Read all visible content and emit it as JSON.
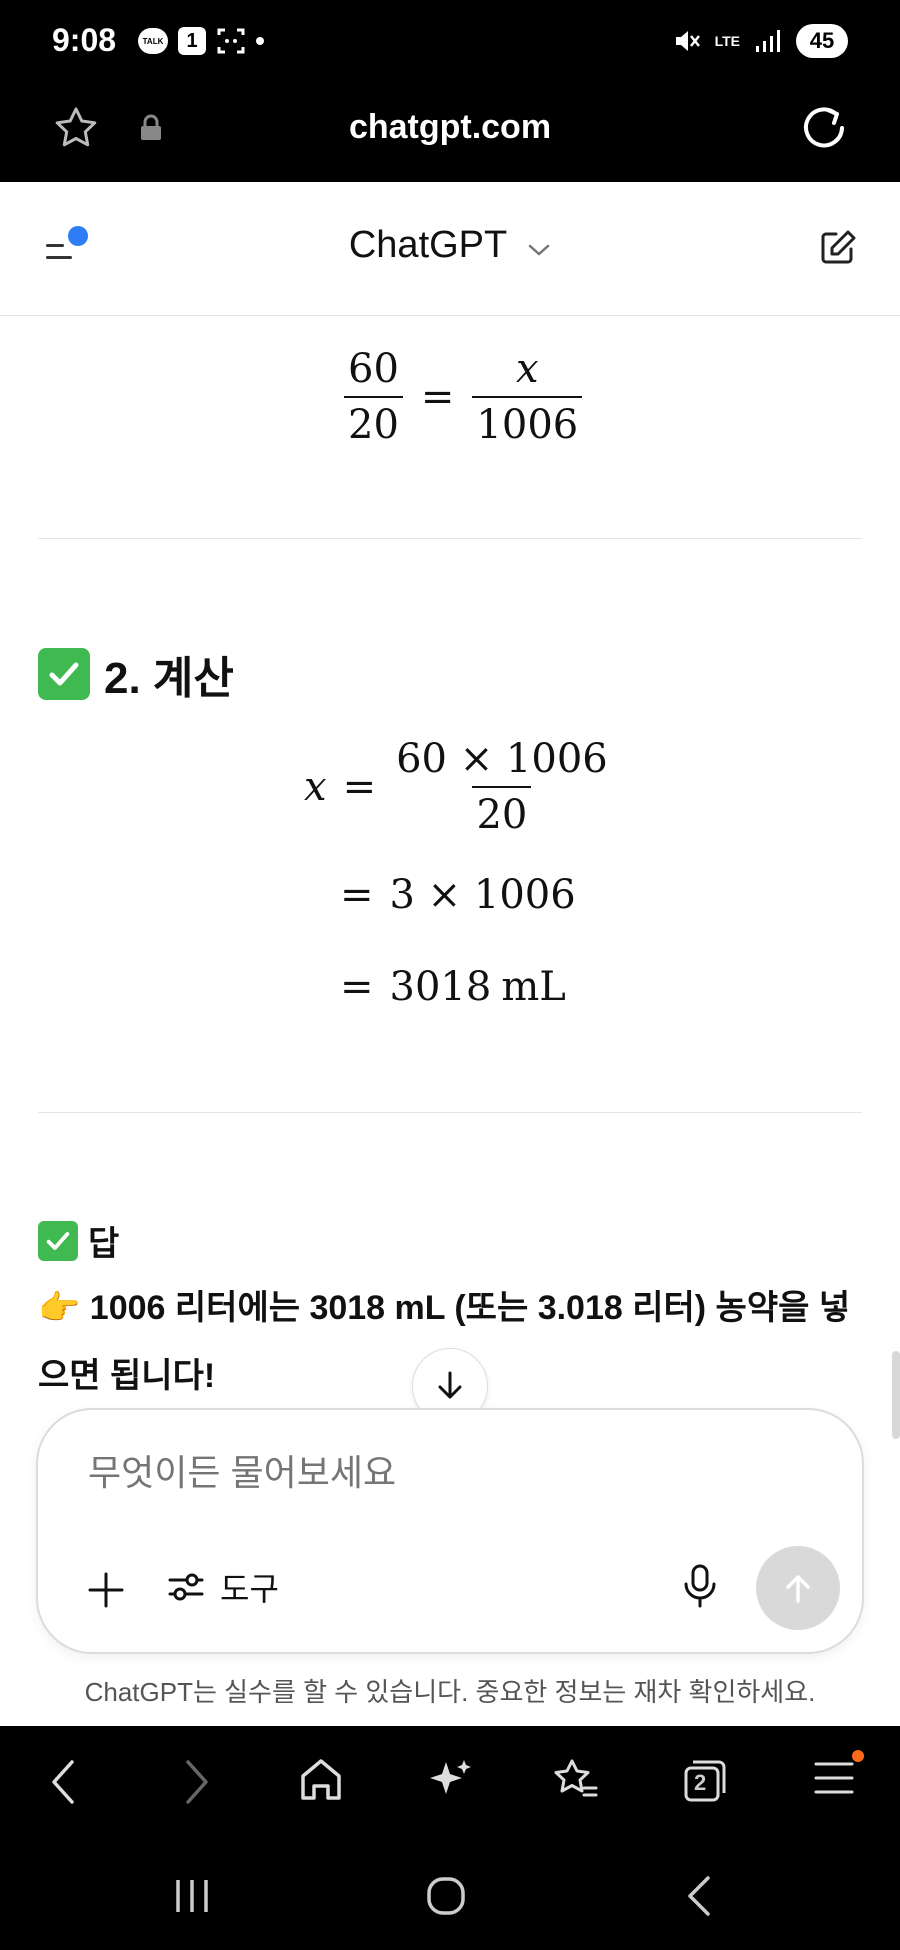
{
  "status_bar": {
    "time": "9:08",
    "talk_label": "TALK",
    "badge": "1",
    "network": "LTE",
    "battery": "45"
  },
  "browser": {
    "url": "chatgpt.com",
    "tab_count": "2"
  },
  "header": {
    "title": "ChatGPT"
  },
  "content": {
    "proportion": {
      "num1": "60",
      "den1": "20",
      "num2": "x",
      "den2": "1006"
    },
    "section2_title": "2. 계산",
    "calc": {
      "x": "x",
      "num": "60 × 1006",
      "den": "20",
      "line2": "3 × 1006",
      "line3_value": "3018",
      "line3_unit": "mL"
    },
    "answer_title": "답",
    "answer_text": "1006 리터에는 3018 mL (또는 3.018 리터) 농약을 넣으면 됩니다!",
    "pointing_emoji": "👉"
  },
  "composer": {
    "placeholder": "무엇이든 물어보세요",
    "tools_label": "도구"
  },
  "disclaimer": "ChatGPT는 실수를 할 수 있습니다. 중요한 정보는 재차 확인하세요.",
  "colors": {
    "check_green": "#3fb950",
    "menu_dot_blue": "#2f7df6",
    "notification_orange": "#ff6a1a"
  }
}
